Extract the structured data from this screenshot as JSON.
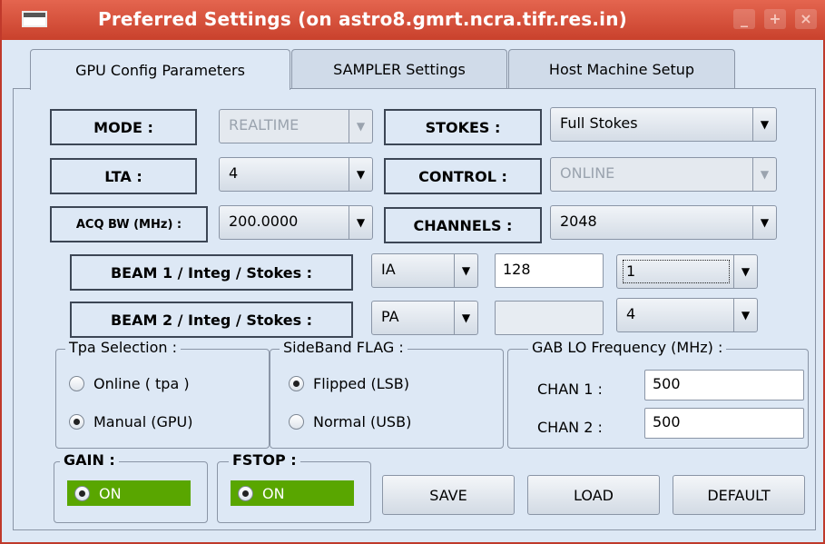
{
  "window": {
    "title": "Preferred Settings (on astro8.gmrt.ncra.tifr.res.in)",
    "controls": {
      "minimize": "_",
      "maximize": "+",
      "close": "×"
    }
  },
  "tabs": [
    {
      "label": "GPU Config Parameters",
      "active": true
    },
    {
      "label": "SAMPLER Settings",
      "active": false
    },
    {
      "label": "Host Machine Setup",
      "active": false
    }
  ],
  "fields": {
    "mode": {
      "label": "MODE :",
      "value": "REALTIME",
      "enabled": false
    },
    "stokes": {
      "label": "STOKES :",
      "value": "Full Stokes",
      "enabled": true
    },
    "lta": {
      "label": "LTA :",
      "value": "4",
      "enabled": true
    },
    "control": {
      "label": "CONTROL :",
      "value": "ONLINE",
      "enabled": false
    },
    "acq_bw": {
      "label": "ACQ BW (MHz) :",
      "value": "200.0000",
      "enabled": true
    },
    "channels": {
      "label": "CHANNELS :",
      "value": "2048",
      "enabled": true
    },
    "beam1": {
      "label": "BEAM 1 / Integ / Stokes :",
      "type": "IA",
      "integ": "128",
      "stokes": "1"
    },
    "beam2": {
      "label": "BEAM 2 / Integ / Stokes :",
      "type": "PA",
      "integ": "",
      "stokes": "4"
    }
  },
  "tpa_selection": {
    "title": "Tpa Selection :",
    "options": [
      {
        "label": "Online ( tpa )",
        "checked": false
      },
      {
        "label": "Manual (GPU)",
        "checked": true
      }
    ]
  },
  "sideband_flag": {
    "title": "SideBand FLAG :",
    "options": [
      {
        "label": "Flipped (LSB)",
        "checked": true
      },
      {
        "label": "Normal (USB)",
        "checked": false
      }
    ]
  },
  "gab_lo": {
    "title": "GAB LO Frequency (MHz) :",
    "chan1_label": "CHAN 1 :",
    "chan1_value": "500",
    "chan2_label": "CHAN 2 :",
    "chan2_value": "500"
  },
  "gain": {
    "title": "GAIN :",
    "state": "ON"
  },
  "fstop": {
    "title": "FSTOP :",
    "state": "ON"
  },
  "buttons": {
    "save": "SAVE",
    "load": "LOAD",
    "default": "DEFAULT"
  },
  "colors": {
    "titlebar": "#c9412c",
    "background": "#dde8f5",
    "on_state": "#59a600"
  },
  "icons": {
    "dropdown": "triangle-down"
  }
}
